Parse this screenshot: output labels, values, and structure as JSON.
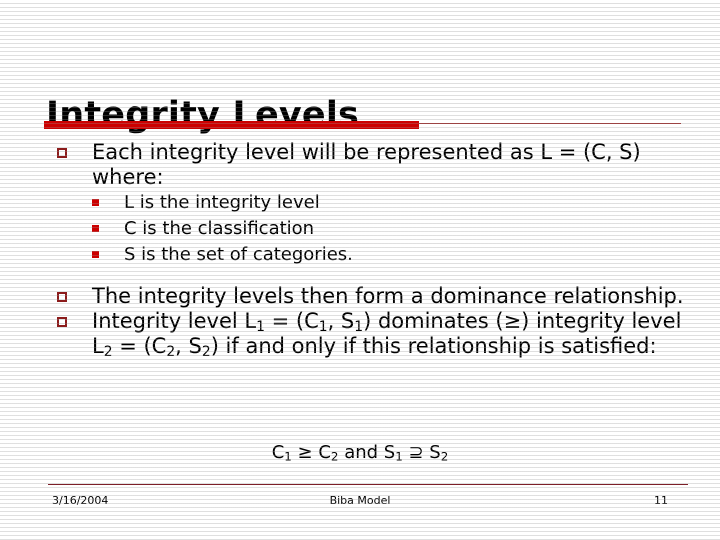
{
  "slide": {
    "title": "Integrity Levels",
    "accent_color": "#cc0000",
    "rule_color": "#9e1f1f",
    "bullet_level1_color": "#8c1b1b",
    "bullet_level2_color": "#cc0000",
    "text_color": "#000000",
    "background_color": "#ffffff"
  },
  "content": {
    "bullets": [
      {
        "marker": "hollow-square-bullet",
        "text": "Each integrity level will be represented as  L = (C, S) where:",
        "sub_bullets": [
          {
            "marker": "filled-square-bullet",
            "text": "L is the integrity level"
          },
          {
            "marker": "filled-square-bullet",
            "text": "C is the classification"
          },
          {
            "marker": "filled-square-bullet",
            "text": "S is the set of categories."
          }
        ]
      },
      {
        "marker": "hollow-square-bullet",
        "text": "The integrity levels then form a dominance relationship.",
        "sub_bullets": []
      },
      {
        "marker": "hollow-square-bullet",
        "text_runs": [
          {
            "t": "Integrity level L"
          },
          {
            "t": "1",
            "sub": true
          },
          {
            "t": " = (C"
          },
          {
            "t": "1",
            "sub": true
          },
          {
            "t": ", S"
          },
          {
            "t": "1",
            "sub": true
          },
          {
            "t": ") dominates (≥) integrity level L"
          },
          {
            "t": "2",
            "sub": true
          },
          {
            "t": " = (C"
          },
          {
            "t": "2",
            "sub": true
          },
          {
            "t": ", S"
          },
          {
            "t": "2",
            "sub": true
          },
          {
            "t": ") if and only if this relationship is satisfied:"
          }
        ],
        "sub_bullets": []
      }
    ],
    "formula_runs": [
      {
        "t": "C"
      },
      {
        "t": "1",
        "sub": true
      },
      {
        "t": " ≥ C"
      },
      {
        "t": "2",
        "sub": true
      },
      {
        "t": " and S"
      },
      {
        "t": "1",
        "sub": true
      },
      {
        "t": " ⊇ S"
      },
      {
        "t": "2",
        "sub": true
      }
    ],
    "formula_plain": "C1 ≥ C2 and S1 ⊇ S2"
  },
  "footer": {
    "date": "3/16/2004",
    "subject": "Biba Model",
    "page_number": "11"
  }
}
